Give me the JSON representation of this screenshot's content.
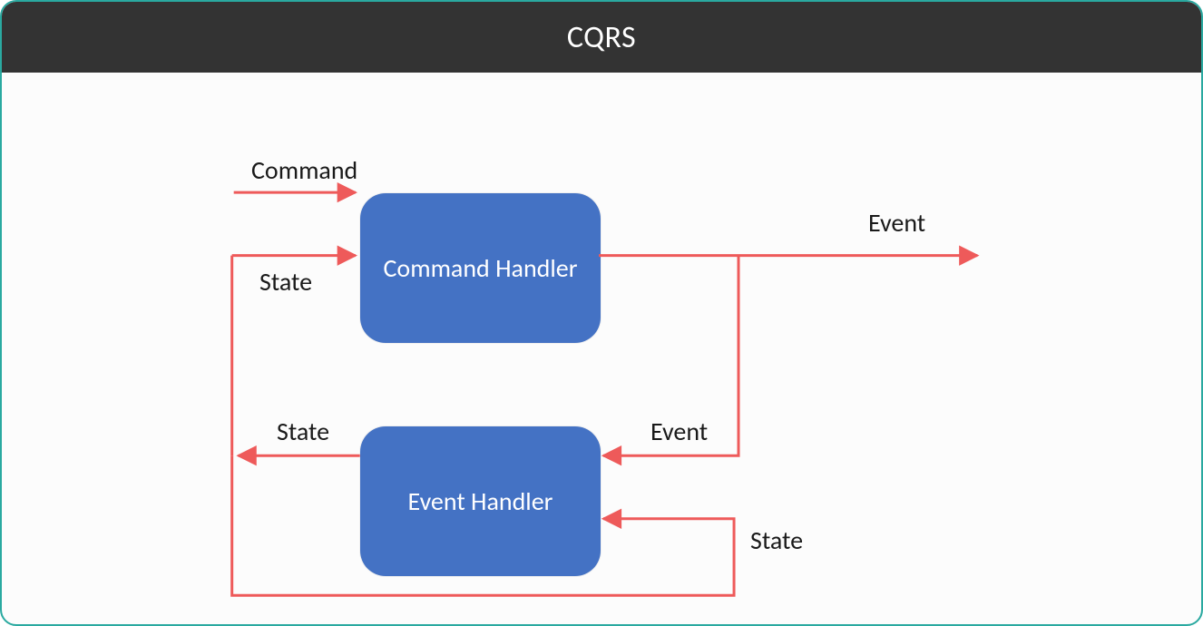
{
  "title": "CQRS",
  "nodes": {
    "command_handler": "Command Handler",
    "event_handler": "Event Handler"
  },
  "labels": {
    "command_in": "Command",
    "state_into_cmd": "State",
    "event_out": "Event",
    "event_into_evt": "Event",
    "state_out_left": "State",
    "state_into_evt": "State"
  },
  "colors": {
    "arrow": "#ee5a5a",
    "node": "#4472c4",
    "titlebar": "#333333",
    "frame": "#2aa9a0"
  },
  "diagram": {
    "description": "CQRS flow: a Command enters the Command Handler, which also receives State. The Command Handler emits an Event. The Event flows to the Event Handler, which also receives State. The Event Handler emits State, which loops back as input State to both handlers.",
    "flows": [
      {
        "from": "external",
        "to": "command_handler",
        "label": "Command"
      },
      {
        "from": "state_bus",
        "to": "command_handler",
        "label": "State"
      },
      {
        "from": "command_handler",
        "to": "external",
        "label": "Event"
      },
      {
        "from": "command_handler",
        "to": "event_handler",
        "label": "Event"
      },
      {
        "from": "state_bus",
        "to": "event_handler",
        "label": "State"
      },
      {
        "from": "event_handler",
        "to": "state_bus",
        "label": "State"
      }
    ]
  }
}
